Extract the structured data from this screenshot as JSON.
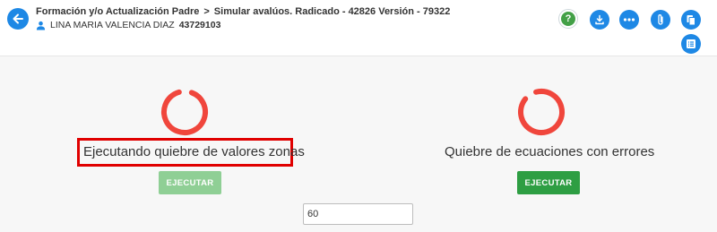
{
  "header": {
    "breadcrumb_root": "Formación y/o Actualización Padre",
    "breadcrumb_separator": ">",
    "breadcrumb_current": "Simular avalúos. Radicado - 42826 Versión - 79322",
    "user_name": "LINA MARIA VALENCIA DIAZ",
    "user_id": "43729103",
    "back_icon": "arrow-left-icon",
    "toolbar_icons": [
      "help-icon",
      "download-icon",
      "more-icon",
      "attachment-icon",
      "copy-icon",
      "list-icon"
    ],
    "help_glyph": "?"
  },
  "panels": {
    "left": {
      "title": "Ejecutando quiebre de valores zonas",
      "button_label": "EJECUTAR",
      "button_state": "disabled"
    },
    "right": {
      "title": "Quiebre de ecuaciones con errores",
      "button_label": "EJECUTAR",
      "button_state": "enabled"
    }
  },
  "input": {
    "value": "60"
  },
  "colors": {
    "accent": "#1e88e5",
    "spinner": "#f0463c",
    "highlight": "#e00000",
    "button_enabled": "#2e9e43",
    "button_disabled": "#8fcf95",
    "help": "#43a047"
  }
}
